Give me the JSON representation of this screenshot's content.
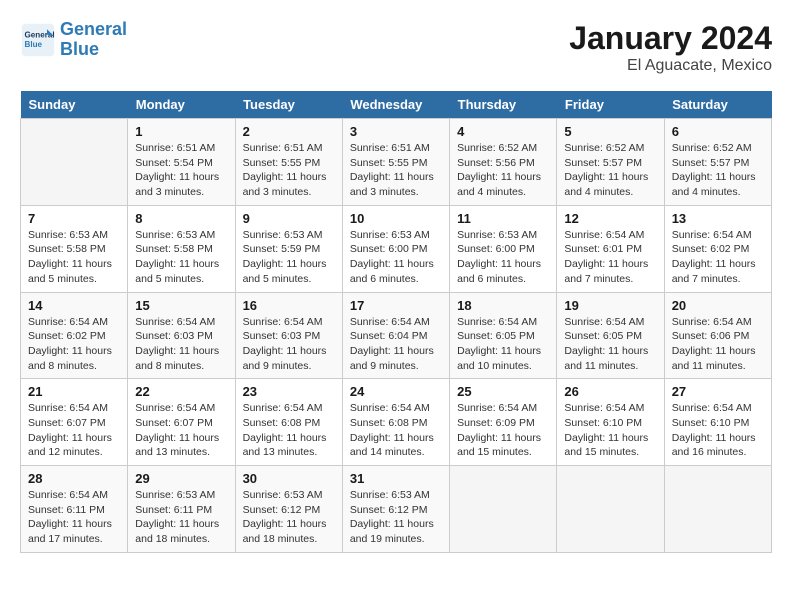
{
  "header": {
    "logo_line1": "General",
    "logo_line2": "Blue",
    "title": "January 2024",
    "subtitle": "El Aguacate, Mexico"
  },
  "days_of_week": [
    "Sunday",
    "Monday",
    "Tuesday",
    "Wednesday",
    "Thursday",
    "Friday",
    "Saturday"
  ],
  "weeks": [
    [
      {
        "num": "",
        "detail": ""
      },
      {
        "num": "1",
        "detail": "Sunrise: 6:51 AM\nSunset: 5:54 PM\nDaylight: 11 hours\nand 3 minutes."
      },
      {
        "num": "2",
        "detail": "Sunrise: 6:51 AM\nSunset: 5:55 PM\nDaylight: 11 hours\nand 3 minutes."
      },
      {
        "num": "3",
        "detail": "Sunrise: 6:51 AM\nSunset: 5:55 PM\nDaylight: 11 hours\nand 3 minutes."
      },
      {
        "num": "4",
        "detail": "Sunrise: 6:52 AM\nSunset: 5:56 PM\nDaylight: 11 hours\nand 4 minutes."
      },
      {
        "num": "5",
        "detail": "Sunrise: 6:52 AM\nSunset: 5:57 PM\nDaylight: 11 hours\nand 4 minutes."
      },
      {
        "num": "6",
        "detail": "Sunrise: 6:52 AM\nSunset: 5:57 PM\nDaylight: 11 hours\nand 4 minutes."
      }
    ],
    [
      {
        "num": "7",
        "detail": "Sunrise: 6:53 AM\nSunset: 5:58 PM\nDaylight: 11 hours\nand 5 minutes."
      },
      {
        "num": "8",
        "detail": "Sunrise: 6:53 AM\nSunset: 5:58 PM\nDaylight: 11 hours\nand 5 minutes."
      },
      {
        "num": "9",
        "detail": "Sunrise: 6:53 AM\nSunset: 5:59 PM\nDaylight: 11 hours\nand 5 minutes."
      },
      {
        "num": "10",
        "detail": "Sunrise: 6:53 AM\nSunset: 6:00 PM\nDaylight: 11 hours\nand 6 minutes."
      },
      {
        "num": "11",
        "detail": "Sunrise: 6:53 AM\nSunset: 6:00 PM\nDaylight: 11 hours\nand 6 minutes."
      },
      {
        "num": "12",
        "detail": "Sunrise: 6:54 AM\nSunset: 6:01 PM\nDaylight: 11 hours\nand 7 minutes."
      },
      {
        "num": "13",
        "detail": "Sunrise: 6:54 AM\nSunset: 6:02 PM\nDaylight: 11 hours\nand 7 minutes."
      }
    ],
    [
      {
        "num": "14",
        "detail": "Sunrise: 6:54 AM\nSunset: 6:02 PM\nDaylight: 11 hours\nand 8 minutes."
      },
      {
        "num": "15",
        "detail": "Sunrise: 6:54 AM\nSunset: 6:03 PM\nDaylight: 11 hours\nand 8 minutes."
      },
      {
        "num": "16",
        "detail": "Sunrise: 6:54 AM\nSunset: 6:03 PM\nDaylight: 11 hours\nand 9 minutes."
      },
      {
        "num": "17",
        "detail": "Sunrise: 6:54 AM\nSunset: 6:04 PM\nDaylight: 11 hours\nand 9 minutes."
      },
      {
        "num": "18",
        "detail": "Sunrise: 6:54 AM\nSunset: 6:05 PM\nDaylight: 11 hours\nand 10 minutes."
      },
      {
        "num": "19",
        "detail": "Sunrise: 6:54 AM\nSunset: 6:05 PM\nDaylight: 11 hours\nand 11 minutes."
      },
      {
        "num": "20",
        "detail": "Sunrise: 6:54 AM\nSunset: 6:06 PM\nDaylight: 11 hours\nand 11 minutes."
      }
    ],
    [
      {
        "num": "21",
        "detail": "Sunrise: 6:54 AM\nSunset: 6:07 PM\nDaylight: 11 hours\nand 12 minutes."
      },
      {
        "num": "22",
        "detail": "Sunrise: 6:54 AM\nSunset: 6:07 PM\nDaylight: 11 hours\nand 13 minutes."
      },
      {
        "num": "23",
        "detail": "Sunrise: 6:54 AM\nSunset: 6:08 PM\nDaylight: 11 hours\nand 13 minutes."
      },
      {
        "num": "24",
        "detail": "Sunrise: 6:54 AM\nSunset: 6:08 PM\nDaylight: 11 hours\nand 14 minutes."
      },
      {
        "num": "25",
        "detail": "Sunrise: 6:54 AM\nSunset: 6:09 PM\nDaylight: 11 hours\nand 15 minutes."
      },
      {
        "num": "26",
        "detail": "Sunrise: 6:54 AM\nSunset: 6:10 PM\nDaylight: 11 hours\nand 15 minutes."
      },
      {
        "num": "27",
        "detail": "Sunrise: 6:54 AM\nSunset: 6:10 PM\nDaylight: 11 hours\nand 16 minutes."
      }
    ],
    [
      {
        "num": "28",
        "detail": "Sunrise: 6:54 AM\nSunset: 6:11 PM\nDaylight: 11 hours\nand 17 minutes."
      },
      {
        "num": "29",
        "detail": "Sunrise: 6:53 AM\nSunset: 6:11 PM\nDaylight: 11 hours\nand 18 minutes."
      },
      {
        "num": "30",
        "detail": "Sunrise: 6:53 AM\nSunset: 6:12 PM\nDaylight: 11 hours\nand 18 minutes."
      },
      {
        "num": "31",
        "detail": "Sunrise: 6:53 AM\nSunset: 6:12 PM\nDaylight: 11 hours\nand 19 minutes."
      },
      {
        "num": "",
        "detail": ""
      },
      {
        "num": "",
        "detail": ""
      },
      {
        "num": "",
        "detail": ""
      }
    ]
  ]
}
